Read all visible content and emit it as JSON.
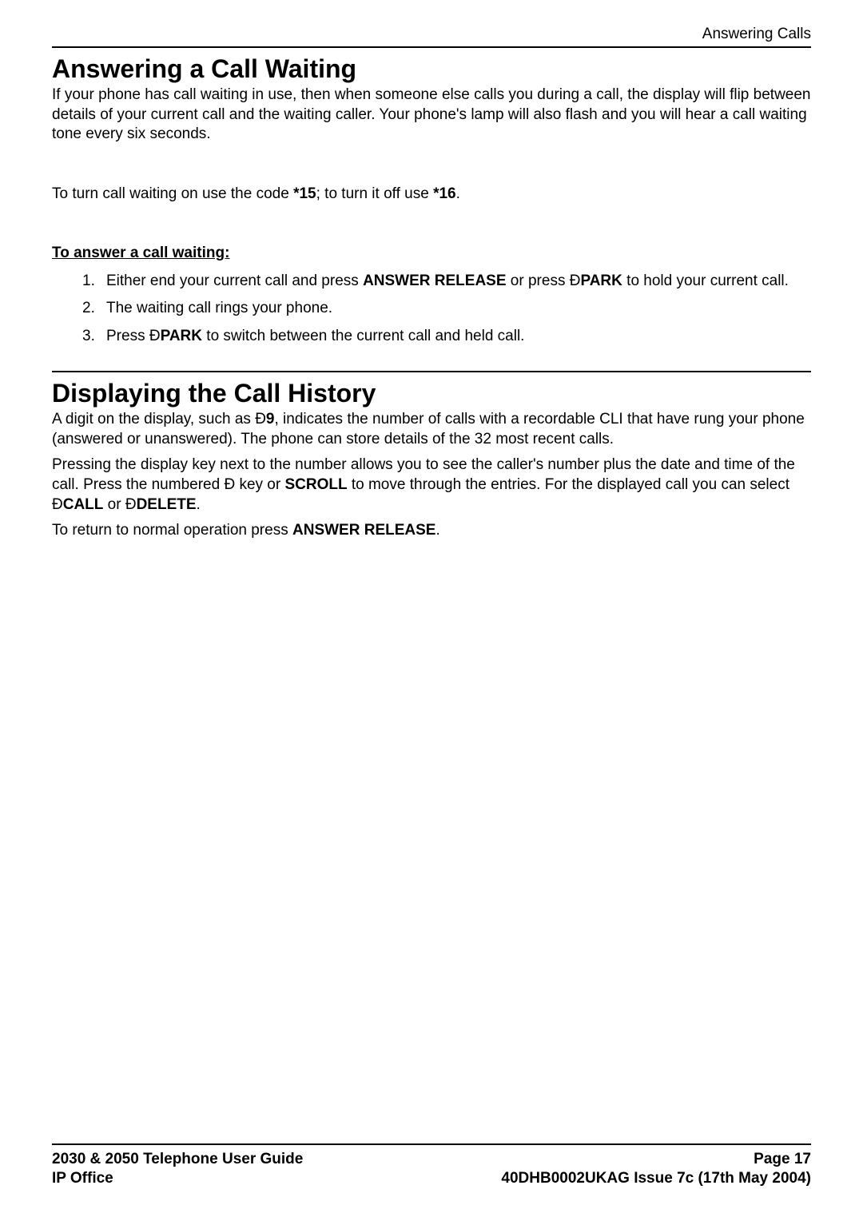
{
  "header": {
    "section_label": "Answering Calls"
  },
  "section1": {
    "title": "Answering a Call Waiting",
    "para1": "If your phone has call waiting in use, then when someone else calls you during a call, the display will flip between details of your current call and the waiting caller. Your phone's lamp will also flash and you will hear a call waiting tone every six seconds.",
    "para2_pre": "To turn call waiting on use the code ",
    "code_on": "*15",
    "para2_mid": "; to turn it off use ",
    "code_off": "*16",
    "para2_end": ".",
    "subheading": "To answer a call waiting:",
    "steps": {
      "s1_num": "1.",
      "s1_a": "Either end your current call and press ",
      "s1_b": "ANSWER RELEASE",
      "s1_c": " or press Ð",
      "s1_d": "PARK",
      "s1_e": " to hold your current call.",
      "s2_num": "2.",
      "s2": "The waiting call rings your phone.",
      "s3_num": "3.",
      "s3_a": "Press Ð",
      "s3_b": "PARK",
      "s3_c": " to switch between the current call and held call."
    }
  },
  "section2": {
    "title": "Displaying the Call History",
    "p1_a": "A digit on the display, such as Ð",
    "p1_b": "9",
    "p1_c": ", indicates the number of calls with a recordable CLI that have rung your phone (answered or unanswered). The phone can store details of the 32 most recent calls.",
    "p2_a": "Pressing the display key next to the number allows you to see the caller's number plus the date and time of the call. Press the numbered Ð key or ",
    "p2_b": "SCROLL",
    "p2_c": " to move through the entries. For the displayed call you can select Ð",
    "p2_d": "CALL",
    "p2_e": " or Ð",
    "p2_f": "DELETE",
    "p2_g": ".",
    "p3_a": "To return to normal operation press ",
    "p3_b": "ANSWER RELEASE",
    "p3_c": "."
  },
  "footer": {
    "left1": "2030 & 2050 Telephone User Guide",
    "left2": "IP Office",
    "right1": "Page 17",
    "right2": "40DHB0002UKAG Issue 7c (17th May 2004)"
  }
}
